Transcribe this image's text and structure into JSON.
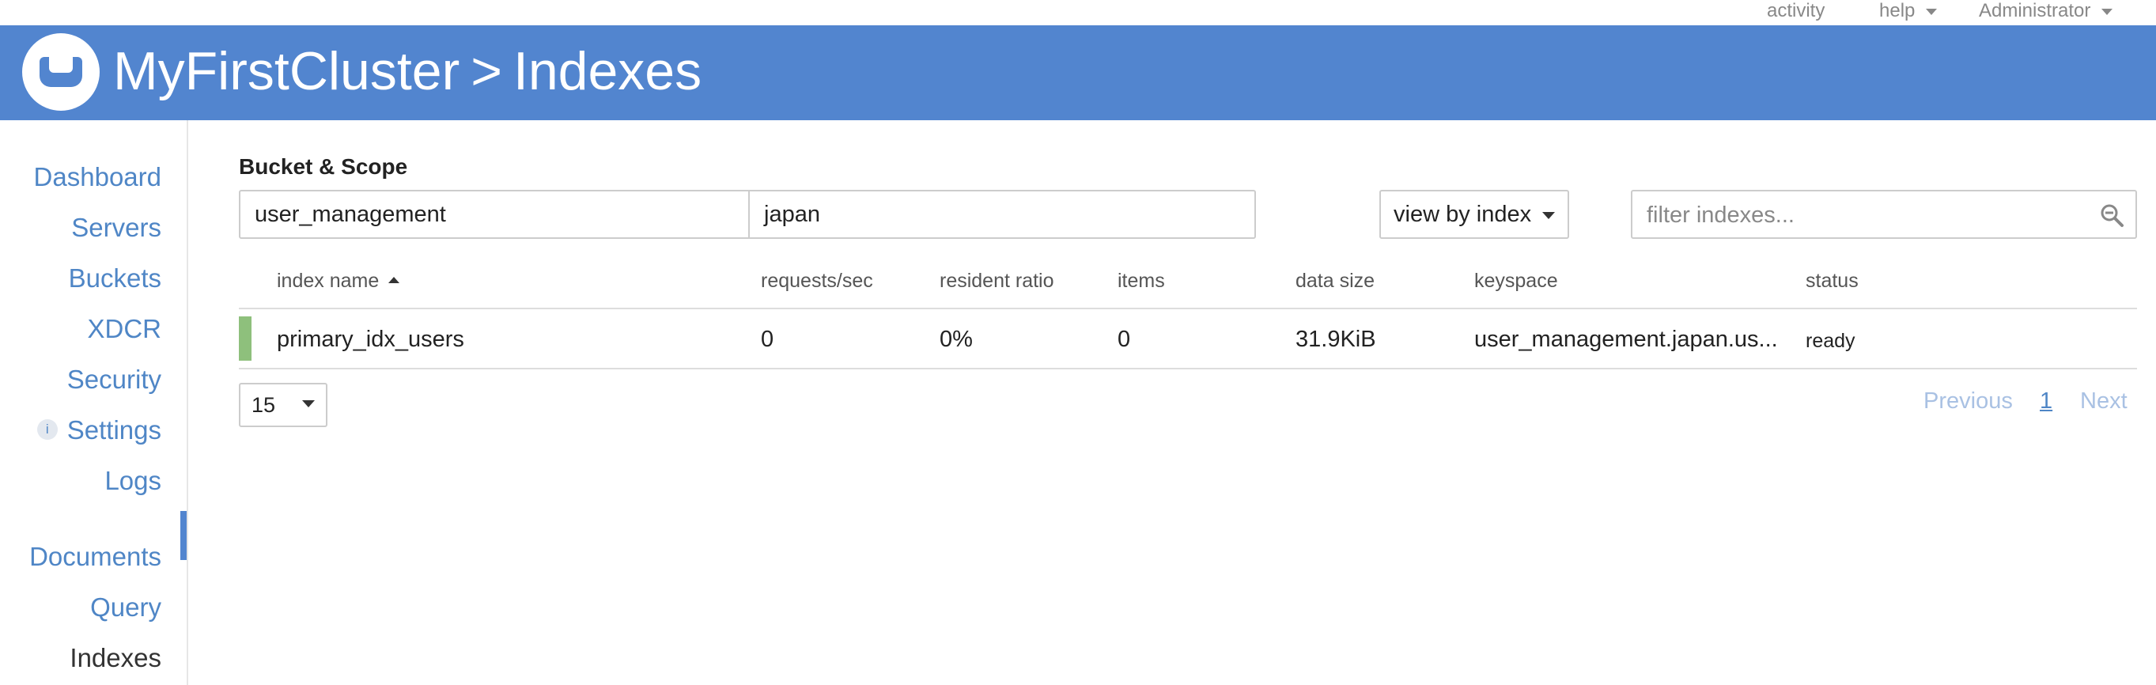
{
  "topbar": {
    "activity": "activity",
    "help": "help",
    "user": "Administrator"
  },
  "header": {
    "cluster": "MyFirstCluster",
    "separator": ">",
    "page": "Indexes"
  },
  "sidebar": {
    "items": [
      {
        "label": "Dashboard"
      },
      {
        "label": "Servers"
      },
      {
        "label": "Buckets"
      },
      {
        "label": "XDCR"
      },
      {
        "label": "Security"
      },
      {
        "label": "Settings",
        "info": "i"
      },
      {
        "label": "Logs"
      },
      {
        "label": "Documents"
      },
      {
        "label": "Query"
      },
      {
        "label": "Indexes",
        "active": true
      }
    ]
  },
  "filters": {
    "bucket_scope_label": "Bucket & Scope",
    "bucket": "user_management",
    "scope": "japan",
    "view_by": "view by index",
    "search_placeholder": "filter indexes..."
  },
  "table": {
    "columns": [
      "index name",
      "requests/sec",
      "resident ratio",
      "items",
      "data size",
      "keyspace",
      "status"
    ],
    "rows": [
      {
        "index_name": "primary_idx_users",
        "requests_sec": "0",
        "resident_ratio": "0%",
        "items": "0",
        "data_size": "31.9KiB",
        "keyspace": "user_management.japan.us...",
        "status": "ready",
        "status_color": "#8ec07c"
      }
    ]
  },
  "pagination": {
    "page_size": "15",
    "previous": "Previous",
    "current": "1",
    "next": "Next"
  },
  "colors": {
    "brand": "#5285cf",
    "link": "#4f86c6",
    "ready": "#8ec07c"
  }
}
